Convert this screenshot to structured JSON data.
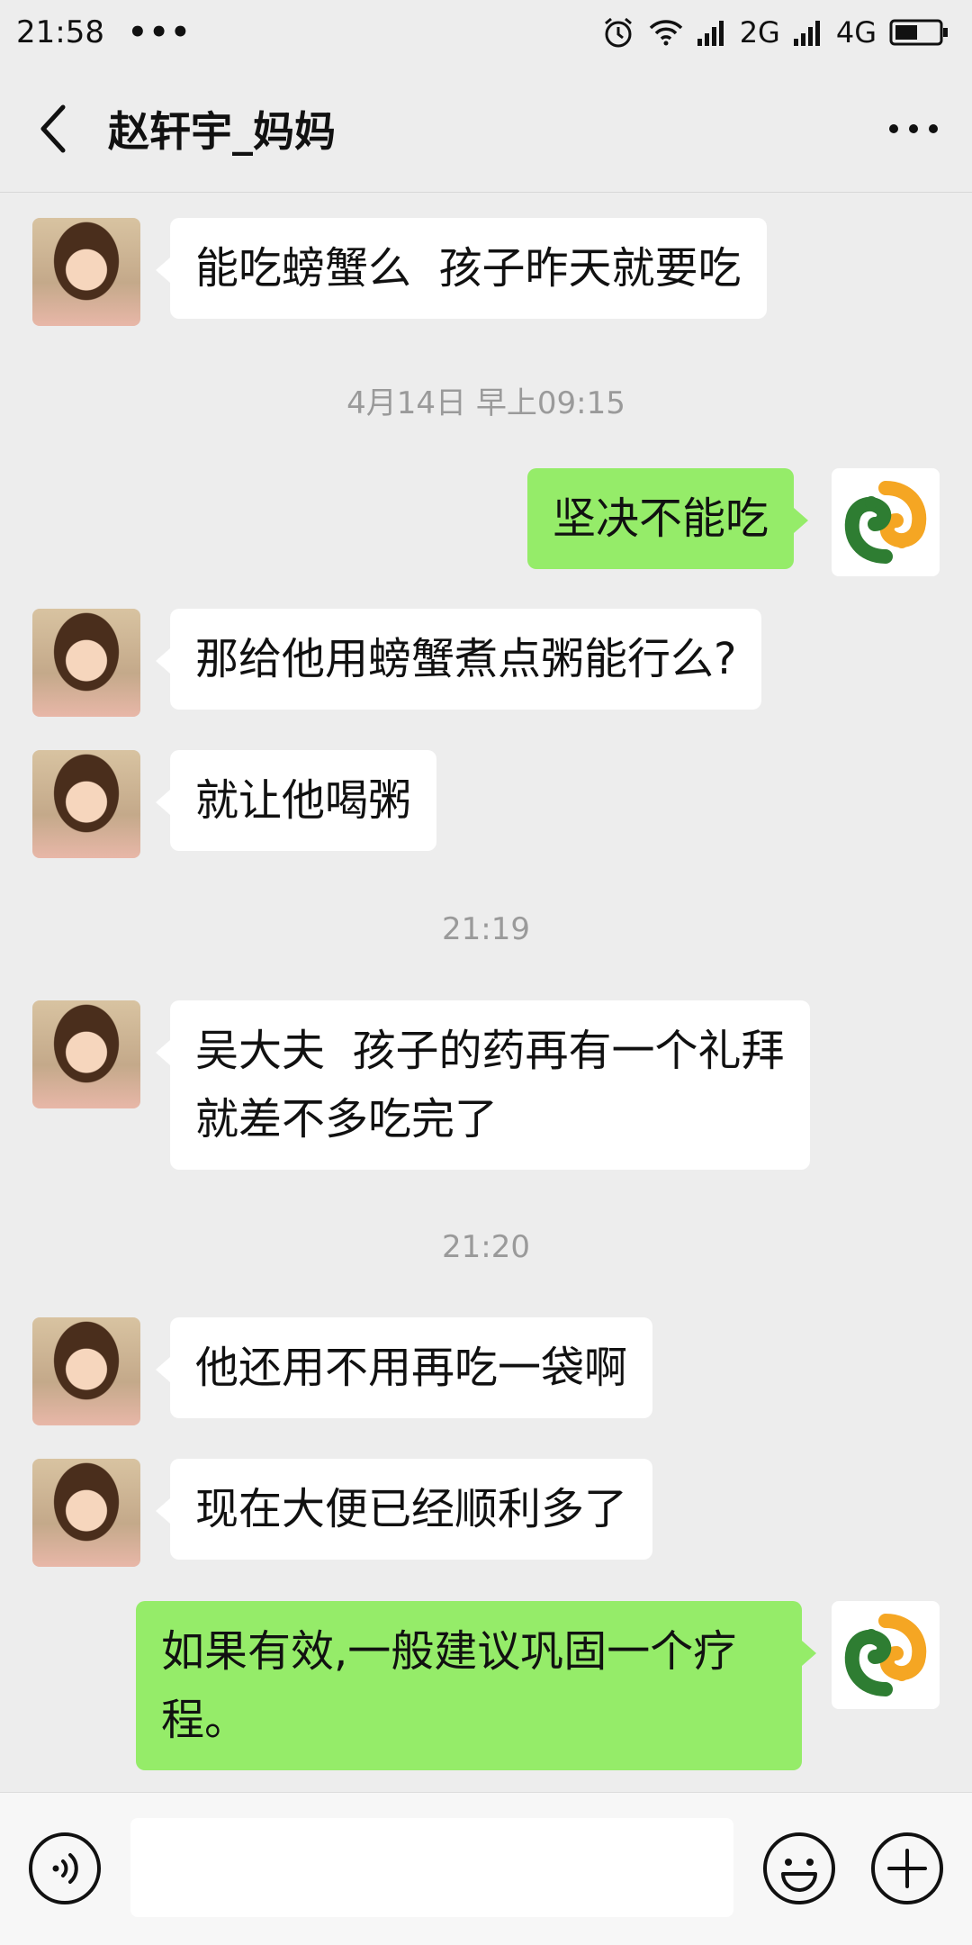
{
  "status_bar": {
    "time": "21:58",
    "dots": "•••",
    "network1": "2G",
    "network2": "4G"
  },
  "header": {
    "title": "赵轩宇_妈妈"
  },
  "messages": [
    {
      "side": "left",
      "text": "能吃螃蟹么  孩子昨天就要吃"
    },
    {
      "type": "timestamp",
      "text": "4月14日 早上09:15"
    },
    {
      "side": "right",
      "text": "坚决不能吃"
    },
    {
      "side": "left",
      "text": "那给他用螃蟹煮点粥能行么?"
    },
    {
      "side": "left",
      "text": "就让他喝粥"
    },
    {
      "type": "timestamp",
      "text": "21:19"
    },
    {
      "side": "left",
      "text": "吴大夫  孩子的药再有一个礼拜\n就差不多吃完了"
    },
    {
      "type": "timestamp",
      "text": "21:20"
    },
    {
      "side": "left",
      "text": "他还用不用再吃一袋啊"
    },
    {
      "side": "left",
      "text": "现在大便已经顺利多了"
    },
    {
      "side": "right",
      "text": "如果有效,一般建议巩固一个疗\n程。"
    }
  ],
  "input": {
    "value": "",
    "placeholder": ""
  },
  "colors": {
    "background": "#ededed",
    "bubble_self": "#95ec69",
    "bubble_other": "#ffffff",
    "logo_green": "#2e7d32",
    "logo_orange": "#f5a623"
  }
}
